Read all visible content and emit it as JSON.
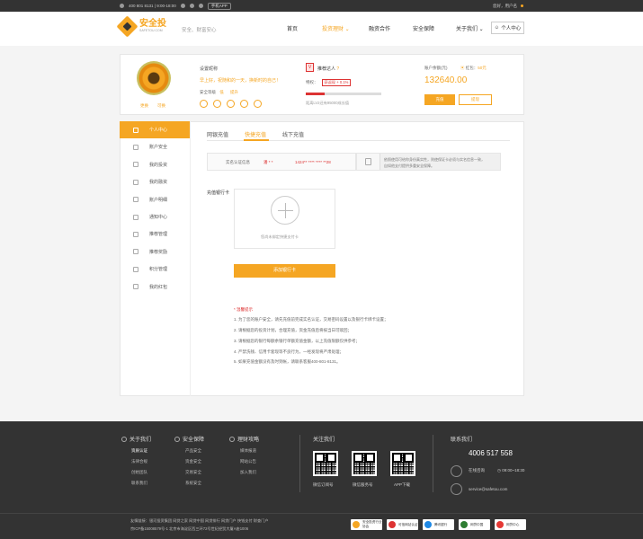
{
  "topbar": {
    "phone": "400 801 8131 | 9:00-18:00",
    "app": "手机APP",
    "user": "您好，用户名"
  },
  "header": {
    "logo_cn": "安全投",
    "logo_en": "SAFETOU.COM",
    "slogan": "安全、财富安心",
    "nav": [
      {
        "label": "首页"
      },
      {
        "label": "投资理财",
        "active": true
      },
      {
        "label": "融资合作"
      },
      {
        "label": "安全保障"
      },
      {
        "label": "关于我们"
      }
    ],
    "user_center": "个人中心"
  },
  "profile": {
    "avatar_links": [
      "更换",
      "可换"
    ],
    "nickname": "设置昵称",
    "greeting": "早上好，祝随和的一天，换新时的自己！",
    "security_label": "安全等级",
    "security_value": "低",
    "security_up": "提升",
    "referrer": {
      "badge": "V",
      "label": "推荐达人",
      "privilege": "特权：",
      "tag": "获返现 + 0.1%",
      "progress": 0.25,
      "progress_note": "距离LV2还有95000成长值"
    },
    "account": {
      "balance_label": "账户余额(元)",
      "hongbao_label": "红包：",
      "hongbao_value": "50元",
      "balance": "132640.00",
      "charge": "充值",
      "withdraw": "提现"
    }
  },
  "sidebar": [
    {
      "label": "个人中心",
      "active": true
    },
    {
      "label": "账户安全"
    },
    {
      "label": "我的投资"
    },
    {
      "label": "我的融资"
    },
    {
      "label": "账户明细"
    },
    {
      "label": "通知中心"
    },
    {
      "label": "推荐管理"
    },
    {
      "label": "推荐奖励"
    },
    {
      "label": "积分管理"
    },
    {
      "label": "我的红包"
    }
  ],
  "tabs": [
    {
      "label": "网银充值"
    },
    {
      "label": "快捷充值",
      "active": true
    },
    {
      "label": "线下充值"
    }
  ],
  "realname": {
    "label": "实名认证信息",
    "name": "潘 * *",
    "id": "1424** **** **** **28"
  },
  "notice": {
    "line1": "依照使用可给你身份真实性，则使保证卡必须与实名信息一致，",
    "line2": "自如他支付提供多重安全保障。"
  },
  "recharge": {
    "card_label": "充值银行卡",
    "tip": "您尚未绑定快捷支付卡",
    "add_btn": "添加银行卡"
  },
  "tips": {
    "title": "* 温馨提示",
    "items": [
      "1. 为了您的账户安全，请先充值前完成实名认证，交易密码设置以及银行卡绑卡设置；",
      "2. 请根据您的投资计划，合理充值，资金充值后将按当日可赎回；",
      "3. 请根据您的银行每额余银行单额充值金额，以上充值限额仅供参考；",
      "4. 严禁洗钱、信用卡套现等不良行为，一经发现将严肃处理；",
      "5. 如果充值金额没有及时到帐，请联系客服400-801-8131。"
    ]
  },
  "footer": {
    "about": {
      "title": "关于我们",
      "links": [
        "资质认证",
        "法律合规",
        "创始团队",
        "联系我们"
      ]
    },
    "safety": {
      "title": "安全保障",
      "links": [
        "产品安全",
        "资金安全",
        "交易安全",
        "系统安全"
      ]
    },
    "guide": {
      "title": "理财攻略",
      "links": [
        "媒体报道",
        "网站公告",
        "加入我们"
      ]
    },
    "follow": {
      "title": "关注我们",
      "qrs": [
        "微信订阅号",
        "微信服务号",
        "APP下载"
      ]
    },
    "contact": {
      "title": "联系我们",
      "phone": "4006 517 558",
      "online": "在线咨询",
      "hours": "09:00~18:30",
      "email": "service@safetou.com"
    },
    "bottom_links": "友情链接：银河投资集团    网贷之家    网贷中国    网贷排行    网贷门户    快钱支付    财查门户",
    "icp": "京ICP备15008579号-1  北京市海淀区西三环72号世纪经贸大厦A座1006",
    "badges": [
      {
        "label": "安全投资行业协会",
        "color": "#f5a623"
      },
      {
        "label": "可信网站认证",
        "color": "#d33"
      },
      {
        "label": "腾讯银行",
        "color": "#1e88e5"
      },
      {
        "label": "网贷中国",
        "color": "#2e7d32"
      },
      {
        "label": "网贷中心",
        "color": "#e53935"
      }
    ]
  }
}
